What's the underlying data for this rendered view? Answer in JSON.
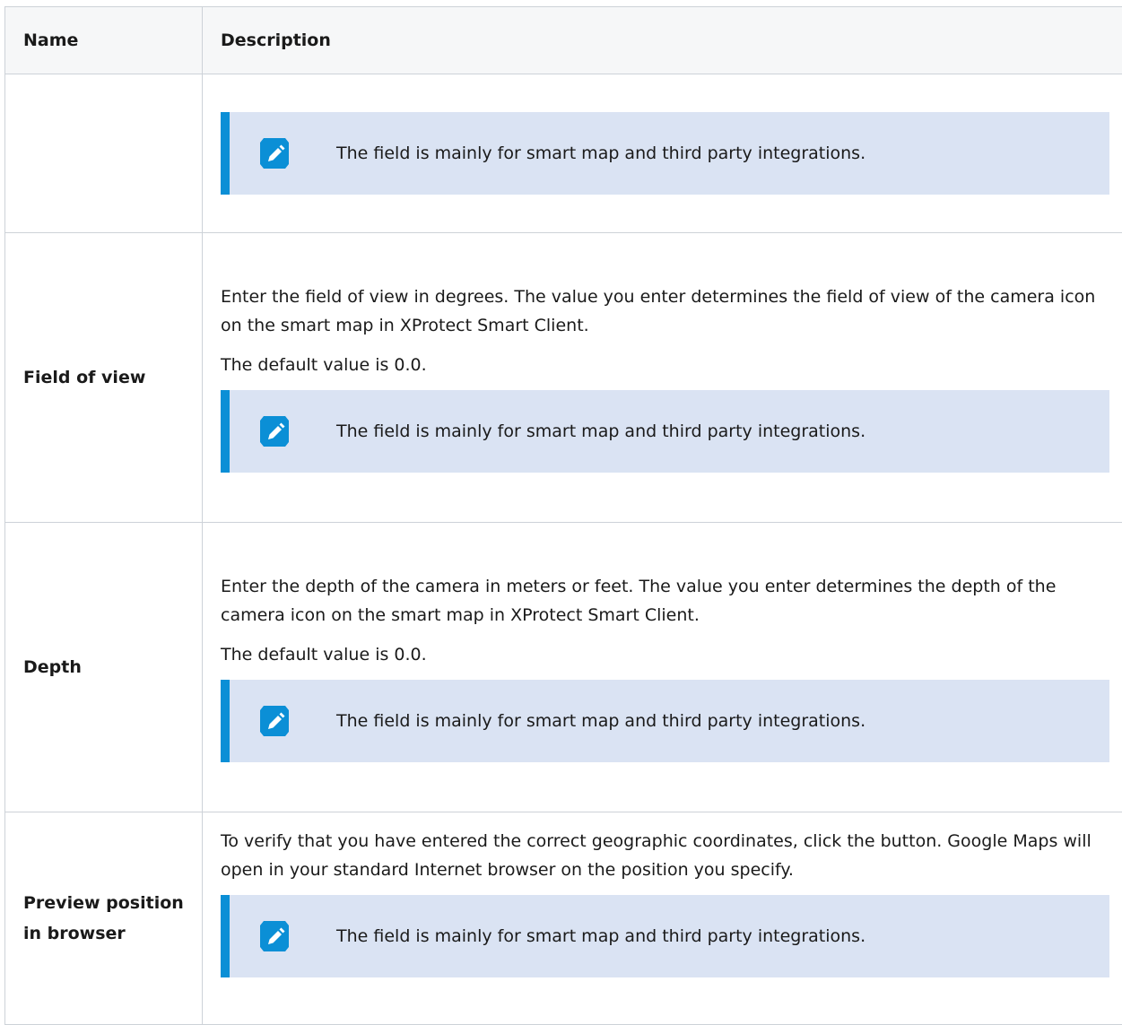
{
  "table": {
    "headers": {
      "name": "Name",
      "description": "Description"
    },
    "note_text": "The field is mainly for smart map and third party integrations.",
    "rows": [
      {
        "name": "",
        "paragraphs": []
      },
      {
        "name": "Field of view",
        "paragraphs": [
          "Enter the field of view in degrees. The value you enter determines the field of view of the camera icon on the smart map in XProtect Smart Client.",
          "The default value is 0.0."
        ]
      },
      {
        "name": "Depth",
        "paragraphs": [
          "Enter the depth of the camera in meters or feet. The value you enter determines the depth of the camera icon on the smart map in XProtect Smart Client.",
          "The default value is 0.0."
        ]
      },
      {
        "name": "Preview position in browser",
        "paragraphs": [
          "To verify that you have entered the correct geographic coordinates, click the button. Google Maps will open in your standard Internet browser on the position you specify."
        ]
      }
    ]
  },
  "colors": {
    "note_background": "#dae3f3",
    "note_accent": "#0b8fd6",
    "border": "#cdd2d8"
  },
  "icons": {
    "note": "pencil-edit-icon"
  }
}
